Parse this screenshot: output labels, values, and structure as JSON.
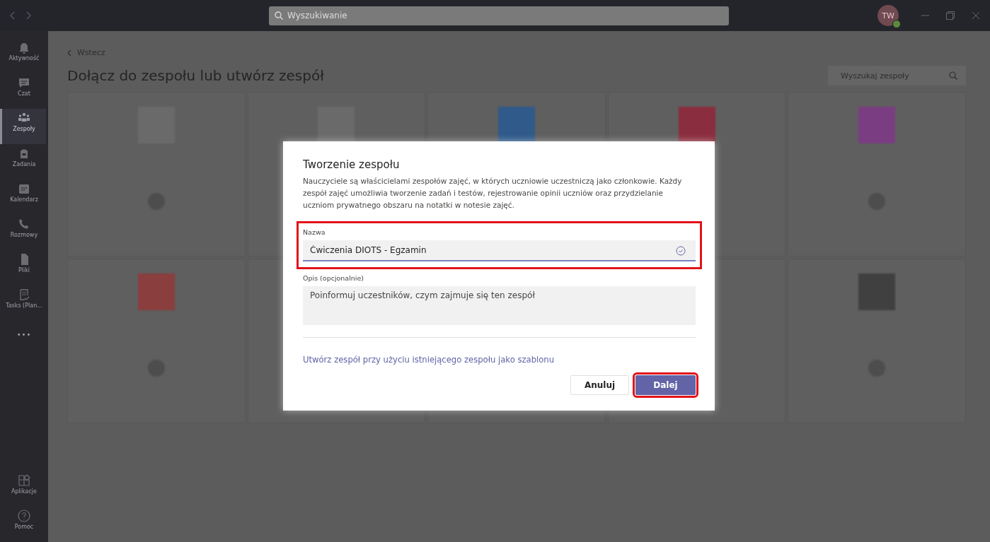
{
  "titlebar": {
    "search_placeholder": "Wyszukiwanie",
    "avatar_initials": "TW"
  },
  "rail": {
    "items": [
      {
        "kind": "bell",
        "label": "Aktywność",
        "selected": false
      },
      {
        "kind": "chat",
        "label": "Czat",
        "selected": false
      },
      {
        "kind": "teams",
        "label": "Zespoły",
        "selected": true
      },
      {
        "kind": "bag",
        "label": "Zadania",
        "selected": false
      },
      {
        "kind": "calendar",
        "label": "Kalendarz",
        "selected": false
      },
      {
        "kind": "phone",
        "label": "Rozmowy",
        "selected": false
      },
      {
        "kind": "file",
        "label": "Pliki",
        "selected": false
      },
      {
        "kind": "tasks",
        "label": "Tasks (Plan...",
        "selected": false
      },
      {
        "kind": "more",
        "label": "•••",
        "selected": false
      }
    ],
    "bottom_items": [
      {
        "kind": "apps",
        "label": "Aplikacje"
      },
      {
        "kind": "help",
        "label": "Pomoc"
      }
    ]
  },
  "main": {
    "back_link": "Wstecz",
    "heading": "Dołącz do zespołu lub utwórz zespół",
    "search_placeholder": "Wyszukaj zespoły",
    "cards": [
      {
        "kind": "team",
        "color": "#6a6a6a",
        "avatar": true
      },
      {
        "kind": "team",
        "color": "#6a6a6a"
      },
      {
        "kind": "team",
        "color": "#2f5a8a"
      },
      {
        "kind": "team",
        "color": "#8a2d3e"
      },
      {
        "kind": "team",
        "color": "#7a3d82",
        "avatar": true
      },
      {
        "kind": "team",
        "color": "#8a3e3e",
        "avatar": true
      },
      {
        "kind": "team"
      },
      {
        "kind": "team"
      },
      {
        "kind": "team"
      },
      {
        "kind": "team",
        "color": "#404040",
        "avatar": true
      }
    ]
  },
  "dialog": {
    "title": "Tworzenie zespołu",
    "description": "Nauczyciele są właścicielami zespołów zajęć, w których uczniowie uczestniczą jako członkowie. Każdy zespół zajęć umożliwia tworzenie zadań i testów, rejestrowanie opinii uczniów oraz przydzielanie uczniom prywatnego obszaru na notatki w notesie zajęć.",
    "name_field": {
      "label": "Nazwa",
      "value": "Ćwiczenia DIOTS - Egzamin",
      "valid": true,
      "highlighted": true
    },
    "description_field": {
      "label": "Opis (opcjonalnie)",
      "placeholder": "Poinformuj uczestników, czym zajmuje się ten zespół"
    },
    "template_link": "Utwórz zespół przy użyciu istniejącego zespołu jako szablonu",
    "buttons": [
      {
        "kind": "secondary",
        "label": "Anuluj",
        "highlighted": false
      },
      {
        "kind": "primary",
        "label": "Dalej",
        "highlighted": true
      }
    ]
  }
}
